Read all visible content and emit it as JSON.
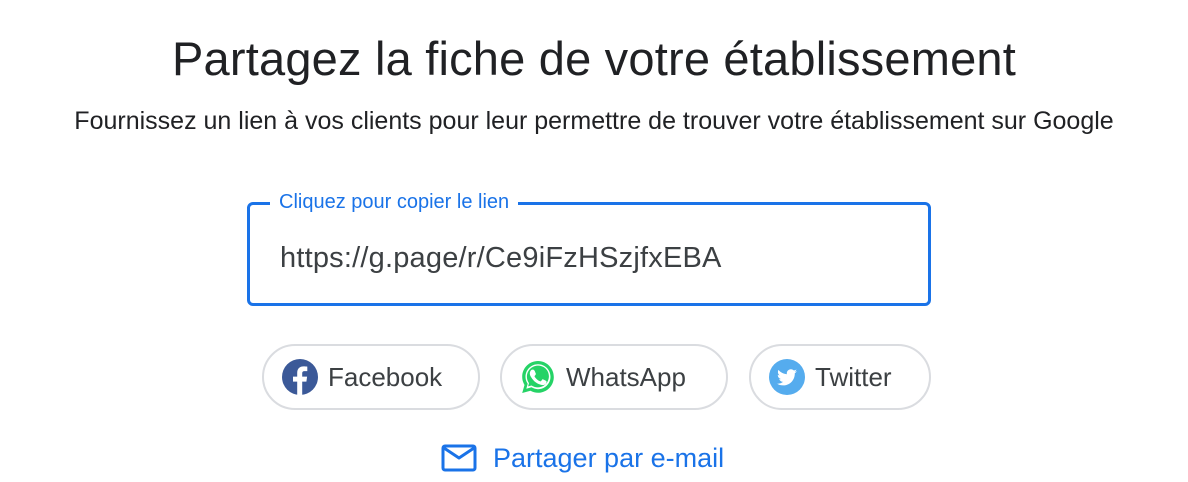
{
  "header": {
    "title": "Partagez la fiche de votre établissement",
    "subtitle": "Fournissez un lien à vos clients pour leur permettre de trouver votre établissement sur Google"
  },
  "link_field": {
    "label": "Cliquez pour copier le lien",
    "value": "https://g.page/r/Ce9iFzHSzjfxEBA"
  },
  "share_buttons": [
    {
      "label": "Facebook",
      "icon": "facebook-icon",
      "color": "#3b5998"
    },
    {
      "label": "WhatsApp",
      "icon": "whatsapp-icon",
      "color": "#25d366"
    },
    {
      "label": "Twitter",
      "icon": "twitter-icon",
      "color": "#55acee"
    }
  ],
  "email_share": {
    "label": "Partager par e-mail",
    "icon": "mail-icon"
  },
  "colors": {
    "accent": "#1a73e8",
    "text": "#202124",
    "chip_border": "#dadce0"
  }
}
